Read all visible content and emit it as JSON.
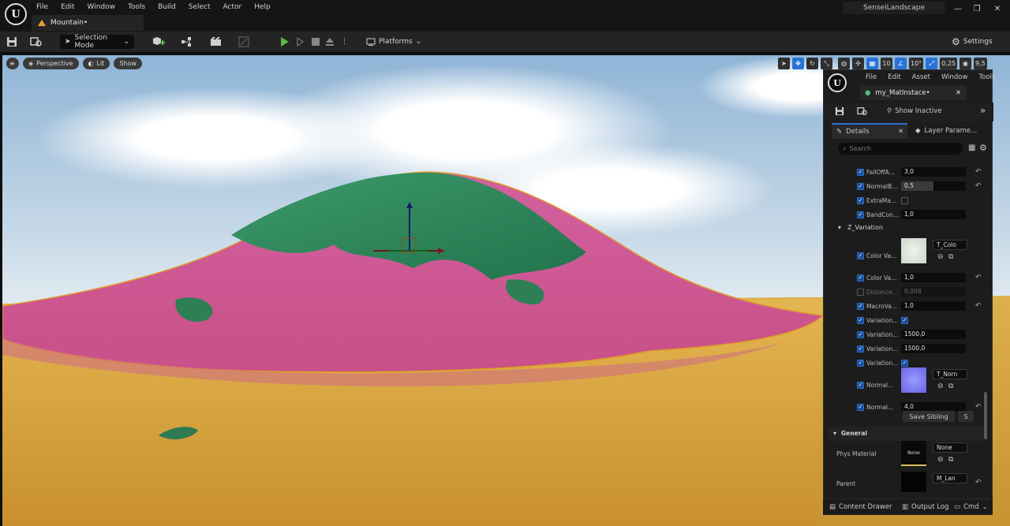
{
  "app": {
    "logo_text": "U",
    "menu": [
      "File",
      "Edit",
      "Window",
      "Tools",
      "Build",
      "Select",
      "Actor",
      "Help"
    ],
    "doc_tab": "Mountain•",
    "project_name": "SenseiLandscape",
    "win_controls": {
      "minimize": "—",
      "maximize": "❐",
      "close": "✕"
    }
  },
  "toolbar": {
    "selection_mode": "Selection Mode",
    "platforms": "Platforms",
    "settings": "Settings"
  },
  "viewport": {
    "buttons": [
      "Perspective",
      "Lit",
      "Show"
    ],
    "grid_snap": "10",
    "rot_snap": "10°",
    "scale_snap": "0,25",
    "cam_speed": "9,5"
  },
  "material": {
    "menu": [
      "File",
      "Edit",
      "Asset",
      "Window",
      "Tools"
    ],
    "tab_title": "my_MatInstace•",
    "show_inactive": "Show Inactive",
    "tab_details": "Details",
    "tab_layer": "Layer Parame...",
    "search_placeholder": "Search",
    "rows": [
      {
        "label": "FallOffA...",
        "checked": true,
        "value": "3,0",
        "reset": true
      },
      {
        "label": "NormalB...",
        "checked": true,
        "value": "0,5",
        "reset": true
      },
      {
        "label": "ExtraMa...",
        "checked": true,
        "bool": false,
        "reset": false
      },
      {
        "label": "BandCon...",
        "checked": true,
        "value": "1,0",
        "reset": false
      },
      {
        "label": "Color Va...",
        "checked": true,
        "value": "1,0",
        "reset": true
      },
      {
        "label": "Distance...",
        "checked": false,
        "value": "0,008",
        "reset": false
      },
      {
        "label": "MacroVa...",
        "checked": true,
        "value": "1,0",
        "reset": true
      },
      {
        "label": "Variation...",
        "checked": true,
        "bool": true,
        "reset": false
      },
      {
        "label": "Variation...",
        "checked": true,
        "value": "1500,0",
        "reset": false
      },
      {
        "label": "Variation...",
        "checked": true,
        "value": "1500,0",
        "reset": false
      },
      {
        "label": "Variation...",
        "checked": true,
        "bool": true,
        "reset": false
      },
      {
        "label": "Normal...",
        "checked": true,
        "value": "4,0",
        "reset": true
      }
    ],
    "z_variation": "Z_Variation",
    "color_tex_label": "Color Va...",
    "color_tex": "T_Colo",
    "normal_tex_label": "Normal...",
    "normal_tex": "T_Norn",
    "save_sibling": "Save Sibling",
    "save_child": "S",
    "general": "General",
    "phys_material_label": "Phys Material",
    "phys_material_thumb": "None",
    "phys_material_value": "None",
    "parent_label": "Parent",
    "parent_value": "M_Lan"
  },
  "status": {
    "content_drawer": "Content Drawer",
    "output_log": "Output Log",
    "cmd": "Cmd"
  },
  "colors": {
    "accent": "#2a73d6",
    "play": "#5db84a",
    "sand": "#d9a43c",
    "grass": "#d2579e",
    "rock": "#2f8a5a"
  }
}
